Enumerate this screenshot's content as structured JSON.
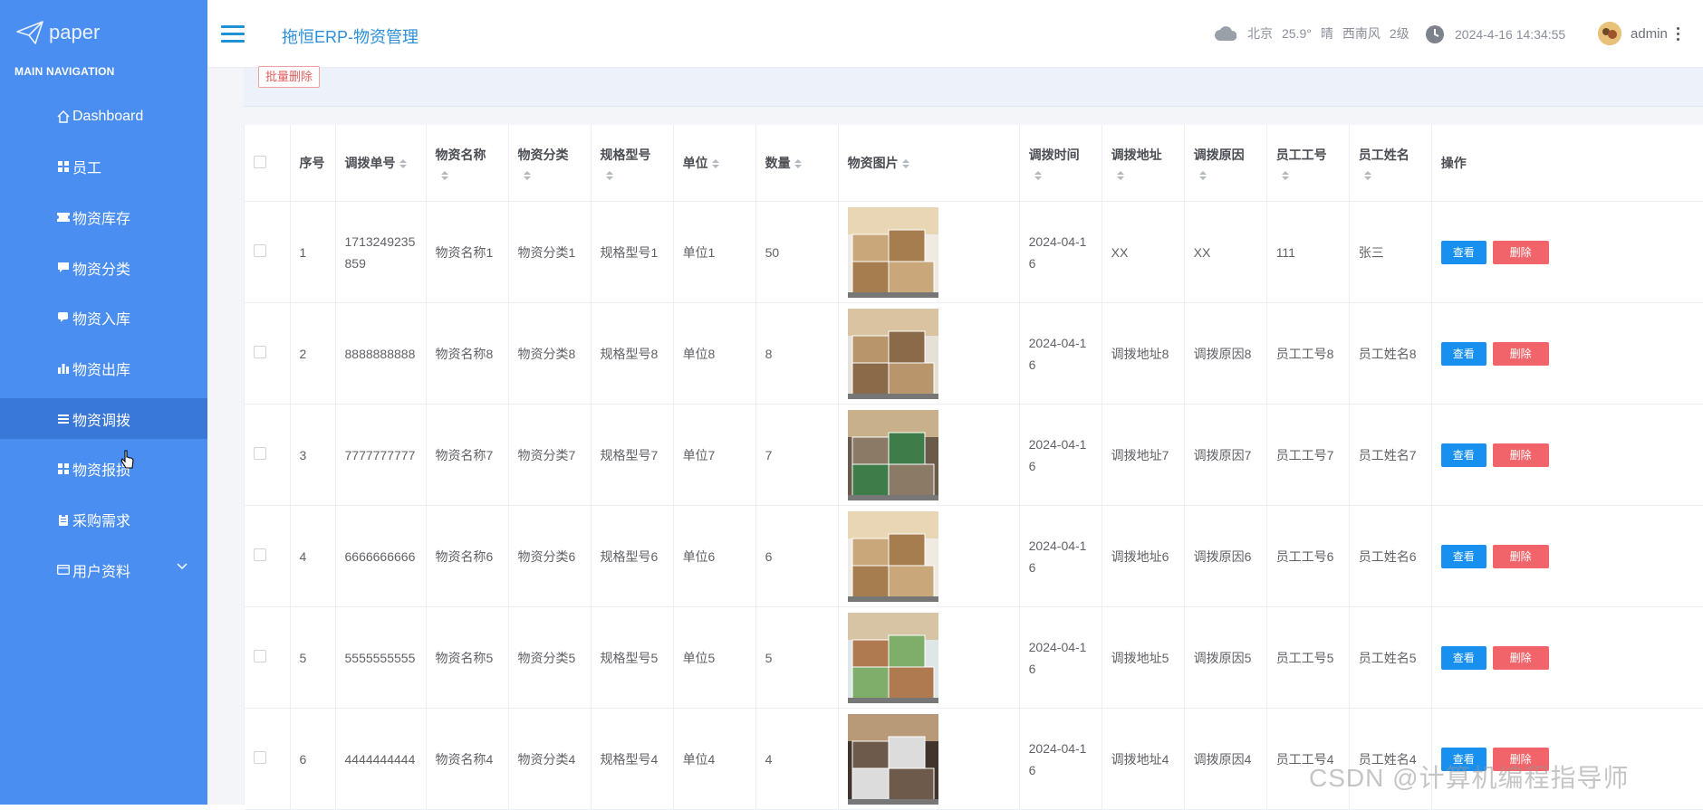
{
  "brand": {
    "logo_text": "paper"
  },
  "sidebar": {
    "heading": "MAIN NAVIGATION",
    "items": [
      {
        "label": "Dashboard",
        "icon": "home-icon"
      },
      {
        "label": "员工",
        "icon": "grid-icon"
      },
      {
        "label": "物资库存",
        "icon": "ticket-icon"
      },
      {
        "label": "物资分类",
        "icon": "comment-icon"
      },
      {
        "label": "物资入库",
        "icon": "chat-icon"
      },
      {
        "label": "物资出库",
        "icon": "bar-chart-icon"
      },
      {
        "label": "物资调拨",
        "icon": "list-icon",
        "active": true
      },
      {
        "label": "物资报损",
        "icon": "grid-icon"
      },
      {
        "label": "采购需求",
        "icon": "clipboard-icon"
      },
      {
        "label": "用户资料",
        "icon": "id-card-icon",
        "has_children": true
      }
    ]
  },
  "header": {
    "title": "拖恒ERP-物资管理",
    "weather": {
      "city": "北京",
      "temp": "25.9°",
      "condition": "晴",
      "wind": "西南风",
      "level": "2级"
    },
    "datetime": "2024-4-16 14:34:55",
    "username": "admin"
  },
  "toolbar": {
    "batch_delete_label": "批量删除"
  },
  "table": {
    "columns": [
      "序号",
      "调拨单号",
      "物资名称",
      "物资分类",
      "规格型号",
      "单位",
      "数量",
      "物资图片",
      "调拨时间",
      "调拨地址",
      "调拨原因",
      "员工工号",
      "员工姓名",
      "操作"
    ],
    "view_label": "查看",
    "delete_label": "删除",
    "rows": [
      {
        "idx": "1",
        "no": "1713249235859",
        "name": "物资名称1",
        "category": "物资分类1",
        "spec": "规格型号1",
        "unit": "单位1",
        "qty": "50",
        "time": "2024-04-16",
        "address": "XX",
        "reason": "XX",
        "emp_no": "111",
        "emp_name": "张三"
      },
      {
        "idx": "2",
        "no": "8888888888",
        "name": "物资名称8",
        "category": "物资分类8",
        "spec": "规格型号8",
        "unit": "单位8",
        "qty": "8",
        "time": "2024-04-16",
        "address": "调拨地址8",
        "reason": "调拨原因8",
        "emp_no": "员工工号8",
        "emp_name": "员工姓名8"
      },
      {
        "idx": "3",
        "no": "7777777777",
        "name": "物资名称7",
        "category": "物资分类7",
        "spec": "规格型号7",
        "unit": "单位7",
        "qty": "7",
        "time": "2024-04-16",
        "address": "调拨地址7",
        "reason": "调拨原因7",
        "emp_no": "员工工号7",
        "emp_name": "员工姓名7"
      },
      {
        "idx": "4",
        "no": "6666666666",
        "name": "物资名称6",
        "category": "物资分类6",
        "spec": "规格型号6",
        "unit": "单位6",
        "qty": "6",
        "time": "2024-04-16",
        "address": "调拨地址6",
        "reason": "调拨原因6",
        "emp_no": "员工工号6",
        "emp_name": "员工姓名6"
      },
      {
        "idx": "5",
        "no": "5555555555",
        "name": "物资名称5",
        "category": "物资分类5",
        "spec": "规格型号5",
        "unit": "单位5",
        "qty": "5",
        "time": "2024-04-16",
        "address": "调拨地址5",
        "reason": "调拨原因5",
        "emp_no": "员工工号5",
        "emp_name": "员工姓名5"
      },
      {
        "idx": "6",
        "no": "4444444444",
        "name": "物资名称4",
        "category": "物资分类4",
        "spec": "规格型号4",
        "unit": "单位4",
        "qty": "4",
        "time": "2024-04-16",
        "address": "调拨地址4",
        "reason": "调拨原因4",
        "emp_no": "员工工号4",
        "emp_name": "员工姓名4"
      }
    ]
  },
  "watermark": "CSDN @计算机编程指导师",
  "colors": {
    "sidebar": "#4a8ef2",
    "sidebar_active": "#3a78d8",
    "title": "#2d8fd9",
    "view_button": "#1890f0",
    "delete_button": "#f0646a"
  }
}
